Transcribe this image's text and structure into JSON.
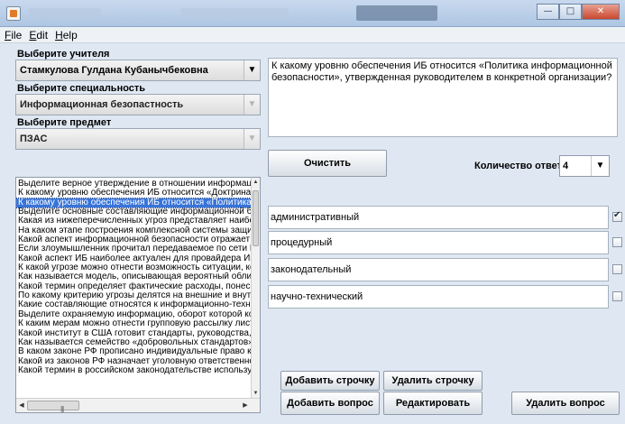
{
  "window": {
    "minimize_glyph": "—",
    "maximize_glyph": "□",
    "close_glyph": "✕"
  },
  "menu": [
    "File",
    "Edit",
    "Help"
  ],
  "teacher": {
    "label": "Выберите учителя",
    "value": "Стамкулова Гулдана Кубанычбековна"
  },
  "specialty": {
    "label": "Выберите специальность",
    "value": "Информационная безопастность"
  },
  "subject": {
    "label": "Выберите предмет",
    "value": "ПЗАС"
  },
  "question_text": "К какому уровню обеспечения ИБ относится «Политика информационной безопасности», утвержденная руководителем в конкретной организации?",
  "buttons": {
    "clear": "Очистить",
    "add_row": "Добавить строчку",
    "delete_row": "Удалить строчку",
    "add_question": "Добавить вопрос",
    "edit": "Редактировать",
    "delete_question": "Удалить вопрос"
  },
  "answer_count": {
    "label": "Количество ответов:",
    "value": "4"
  },
  "answers": [
    {
      "text": "административный",
      "checked": true
    },
    {
      "text": "процедурный",
      "checked": false
    },
    {
      "text": "законодательный",
      "checked": false
    },
    {
      "text": "научно-технический",
      "checked": false
    }
  ],
  "questions": [
    "Выделите верное утверждение в отношении информационной безопасности",
    "К какому уровню обеспечения ИБ относится «Доктрина информационной безопасности»",
    "К какому уровню обеспечения ИБ относится «Политика информационной безопасности»",
    "Выделите основные составляющие информационной безопасности",
    "Какая из нижеперечисленных угроз представляет наибольшую опасность",
    "На каком этапе построения комплексной системы защиты информации",
    "Какой аспект информационной безопасности отражает актуальность",
    "Если злоумышленник прочитал передаваемое по сети Интернет сообщение",
    "Какой аспект ИБ наиболее актуален для провайдера Интернет-услуг",
    "К какой угрозе можно отнести возможность ситуации, когда",
    "Как называется модель, описывающая вероятный облик злоумышленника",
    "Какой термин определяет фактические расходы, понесенные субъектом",
    "По какому критерию угрозы делятся на внешние и внутренние",
    "Какие составляющие относятся к информационно-технологическим",
    "Выделите охраняемую информацию, оборот которой контролируется",
    "К каким мерам можно отнести групповую рассылку листовок",
    "Какой институт в США готовит стандарты, руководства, средства",
    "Как называется семейство «добровольных стандартов» Европы",
    "В каком законе РФ прописано индивидуальные право каждого",
    "Какой из законов РФ назначает уголовную ответственность",
    "Какой термин в российском законодательстве используется"
  ],
  "selected_question_index": 2
}
